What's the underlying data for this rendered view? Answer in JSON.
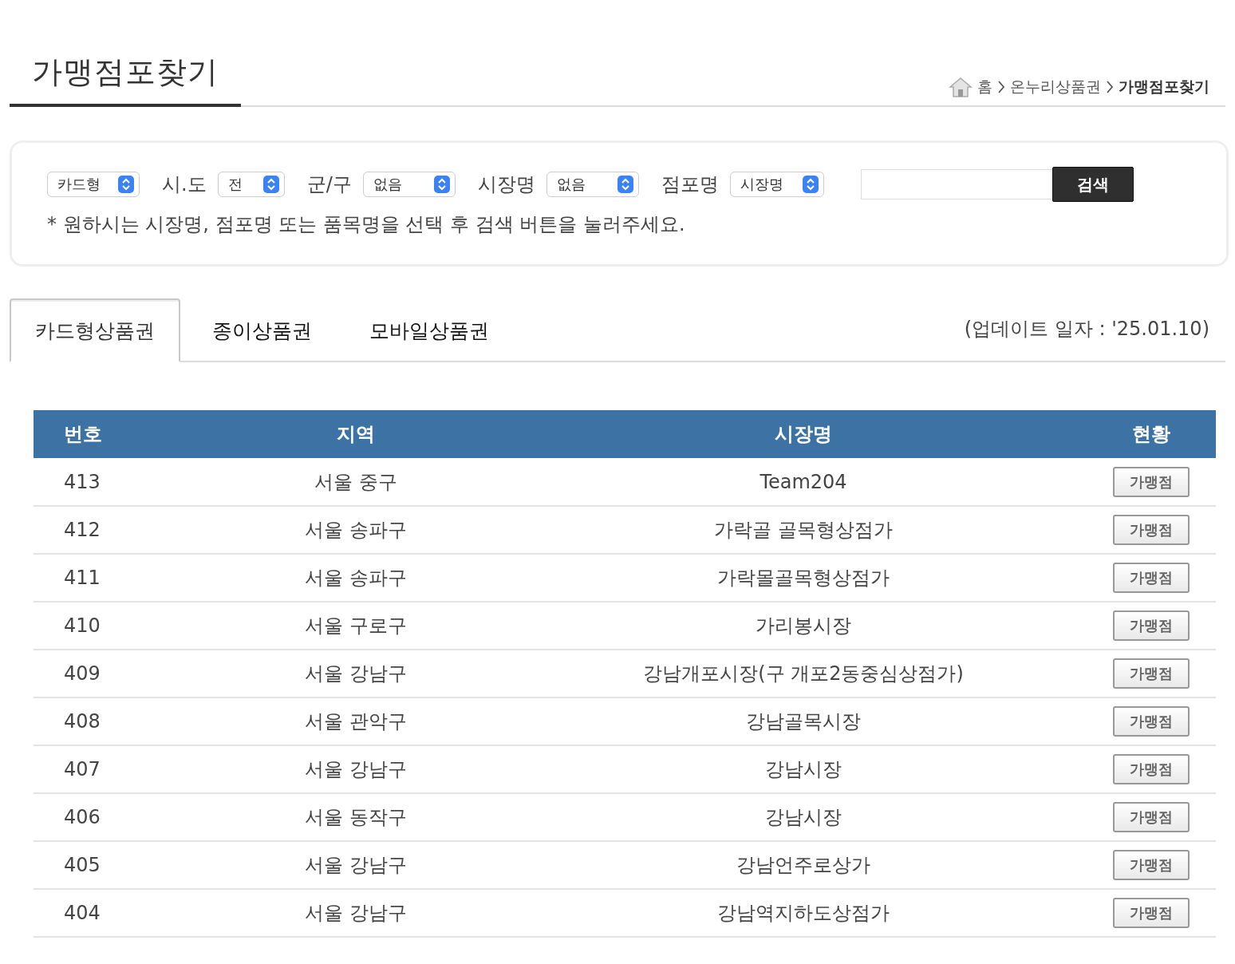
{
  "page_title": "가맹점포찾기",
  "breadcrumb": [
    "홈",
    "온누리상품권",
    "가맹점포찾기"
  ],
  "search": {
    "filters": [
      {
        "value": "카드형"
      },
      {
        "label": "시.도",
        "value": "전"
      },
      {
        "label": "군/구",
        "value": "없음"
      },
      {
        "label": "시장명",
        "value": "없음"
      },
      {
        "label": "점포명",
        "value": "시장명"
      }
    ],
    "button": "검색",
    "hint": "* 원하시는 시장명, 점포명 또는 품목명을 선택 후 검색 버튼을 눌러주세요."
  },
  "tabs": [
    {
      "label": "카드형상품권",
      "selected": true
    },
    {
      "label": "종이상품권",
      "selected": false
    },
    {
      "label": "모바일상품권",
      "selected": false
    }
  ],
  "update_note": "(업데이트 일자 : '25.01.10)",
  "table": {
    "columns": [
      "번호",
      "지역",
      "시장명",
      "현황"
    ],
    "rows": [
      {
        "no": "413",
        "region": "서울 중구",
        "market": "Team204",
        "action": "가맹점"
      },
      {
        "no": "412",
        "region": "서울 송파구",
        "market": "가락골 골목형상점가",
        "action": "가맹점"
      },
      {
        "no": "411",
        "region": "서울 송파구",
        "market": "가락몰골목형상점가",
        "action": "가맹점"
      },
      {
        "no": "410",
        "region": "서울 구로구",
        "market": "가리봉시장",
        "action": "가맹점"
      },
      {
        "no": "409",
        "region": "서울 강남구",
        "market": "강남개포시장(구 개포2동중심상점가)",
        "action": "가맹점"
      },
      {
        "no": "408",
        "region": "서울 관악구",
        "market": "강남골목시장",
        "action": "가맹점"
      },
      {
        "no": "407",
        "region": "서울 강남구",
        "market": "강남시장",
        "action": "가맹점"
      },
      {
        "no": "406",
        "region": "서울 동작구",
        "market": "강남시장",
        "action": "가맹점"
      },
      {
        "no": "405",
        "region": "서울 강남구",
        "market": "강남언주로상가",
        "action": "가맹점"
      },
      {
        "no": "404",
        "region": "서울 강남구",
        "market": "강남역지하도상점가",
        "action": "가맹점"
      }
    ]
  }
}
